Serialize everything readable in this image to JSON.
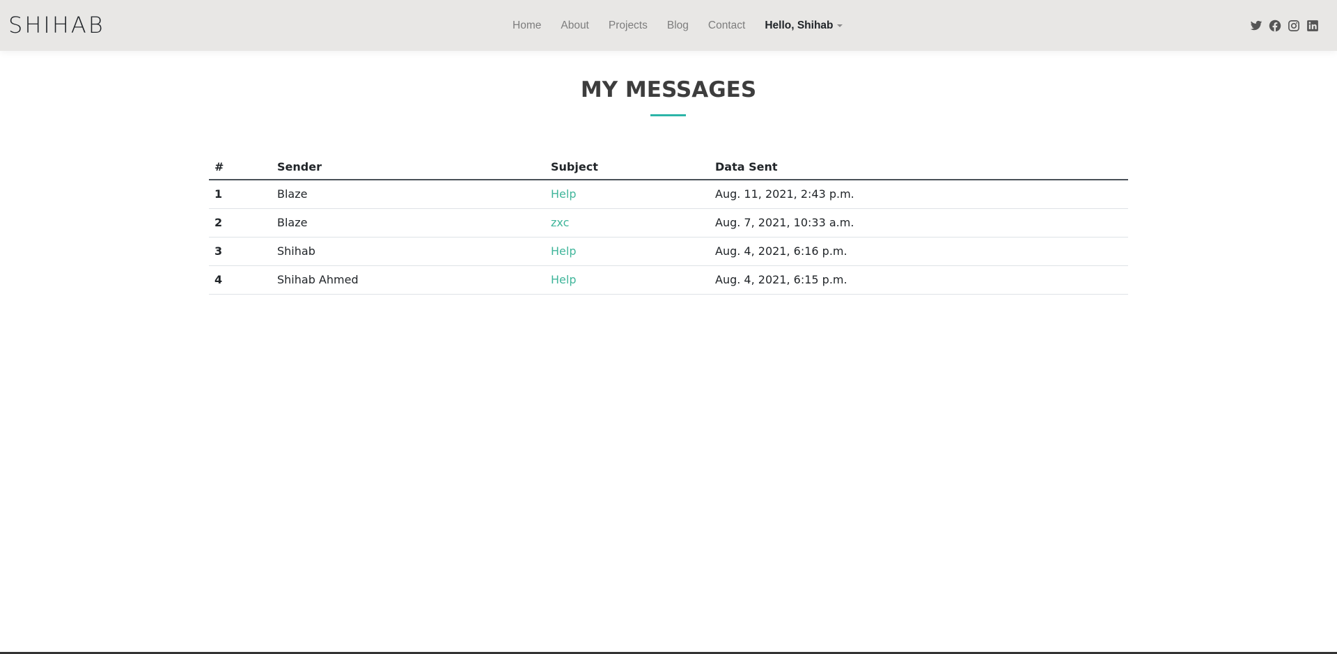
{
  "navbar": {
    "brand": "SHIHAB",
    "links": [
      "Home",
      "About",
      "Projects",
      "Blog",
      "Contact"
    ],
    "user_menu": "Hello, Shihab",
    "social_icons": [
      "twitter-icon",
      "facebook-icon",
      "instagram-icon",
      "linkedin-icon"
    ]
  },
  "page": {
    "title": "MY MESSAGES",
    "accent_color": "#2cb5a8",
    "link_color": "#3fb59a"
  },
  "table": {
    "headers": [
      "#",
      "Sender",
      "Subject",
      "Data Sent"
    ],
    "rows": [
      {
        "num": "1",
        "sender": "Blaze",
        "subject": "Help",
        "date": "Aug. 11, 2021, 2:43 p.m."
      },
      {
        "num": "2",
        "sender": "Blaze",
        "subject": "zxc",
        "date": "Aug. 7, 2021, 10:33 a.m."
      },
      {
        "num": "3",
        "sender": "Shihab",
        "subject": "Help",
        "date": "Aug. 4, 2021, 6:16 p.m."
      },
      {
        "num": "4",
        "sender": "Shihab Ahmed",
        "subject": "Help",
        "date": "Aug. 4, 2021, 6:15 p.m."
      }
    ]
  }
}
